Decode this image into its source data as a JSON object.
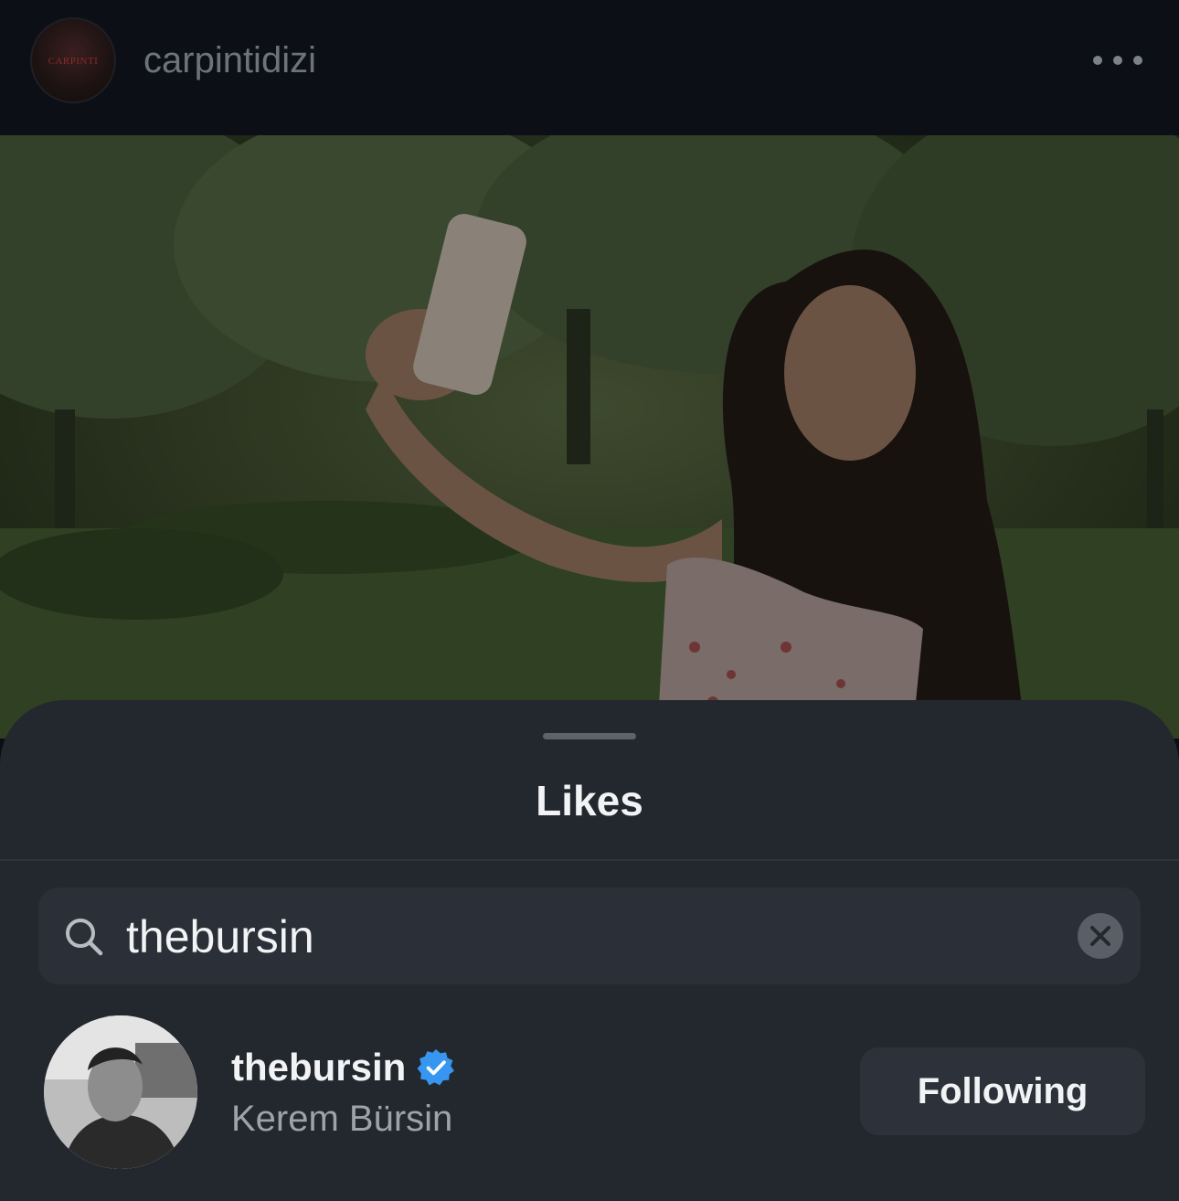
{
  "post_header": {
    "username": "carpintidizi",
    "avatar_logo_text": "CARPINTI"
  },
  "likes_sheet": {
    "title": "Likes",
    "search": {
      "value": "thebursin",
      "placeholder": "Search"
    },
    "results": [
      {
        "username": "thebursin",
        "full_name": "Kerem Bürsin",
        "verified": true,
        "follow_button_label": "Following"
      }
    ]
  },
  "icons": {
    "more": "more-horizontal-icon",
    "search": "search-icon",
    "clear": "clear-x-icon",
    "verified": "verified-badge-icon"
  },
  "colors": {
    "background": "#0c1016",
    "sheet": "#23272e",
    "search_field": "#2b2f37",
    "verified_blue": "#3797f0",
    "button": "#2d3139"
  }
}
